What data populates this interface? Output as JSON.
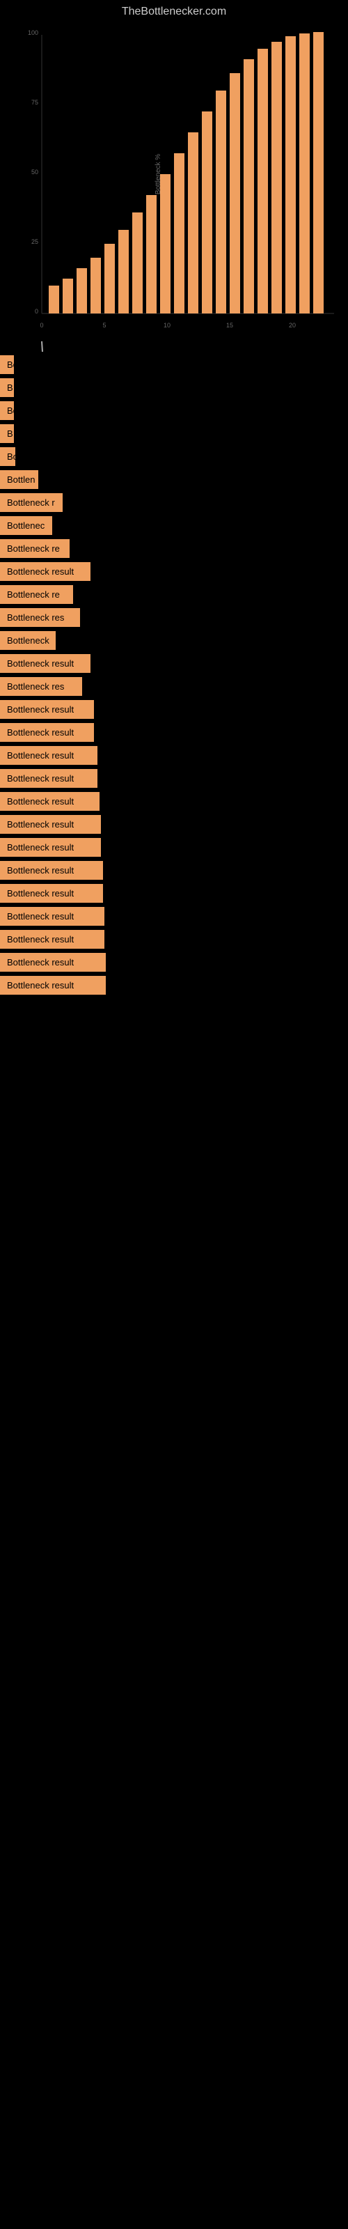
{
  "site": {
    "title": "TheBottlenecker.com"
  },
  "bottleneck_items": [
    {
      "label": "Bottleneck result",
      "width": 18
    },
    {
      "label": "B",
      "width": 16
    },
    {
      "label": "Bo",
      "width": 20
    },
    {
      "label": "B",
      "width": 14
    },
    {
      "label": "Bo",
      "width": 22
    },
    {
      "label": "Bottlen",
      "width": 55
    },
    {
      "label": "Bottleneck r",
      "width": 90
    },
    {
      "label": "Bottlenec",
      "width": 75
    },
    {
      "label": "Bottleneck re",
      "width": 100
    },
    {
      "label": "Bottleneck result",
      "width": 130
    },
    {
      "label": "Bottleneck re",
      "width": 105
    },
    {
      "label": "Bottleneck res",
      "width": 115
    },
    {
      "label": "Bottleneck",
      "width": 80
    },
    {
      "label": "Bottleneck result",
      "width": 130
    },
    {
      "label": "Bottleneck res",
      "width": 118
    },
    {
      "label": "Bottleneck result",
      "width": 135
    },
    {
      "label": "Bottleneck result",
      "width": 135
    },
    {
      "label": "Bottleneck result",
      "width": 140
    },
    {
      "label": "Bottleneck result",
      "width": 140
    },
    {
      "label": "Bottleneck result",
      "width": 143
    },
    {
      "label": "Bottleneck result",
      "width": 145
    },
    {
      "label": "Bottleneck result",
      "width": 145
    },
    {
      "label": "Bottleneck result",
      "width": 148
    },
    {
      "label": "Bottleneck result",
      "width": 148
    },
    {
      "label": "Bottleneck result",
      "width": 150
    },
    {
      "label": "Bottleneck result",
      "width": 150
    },
    {
      "label": "Bottleneck result",
      "width": 152
    },
    {
      "label": "Bottleneck result",
      "width": 152
    }
  ]
}
